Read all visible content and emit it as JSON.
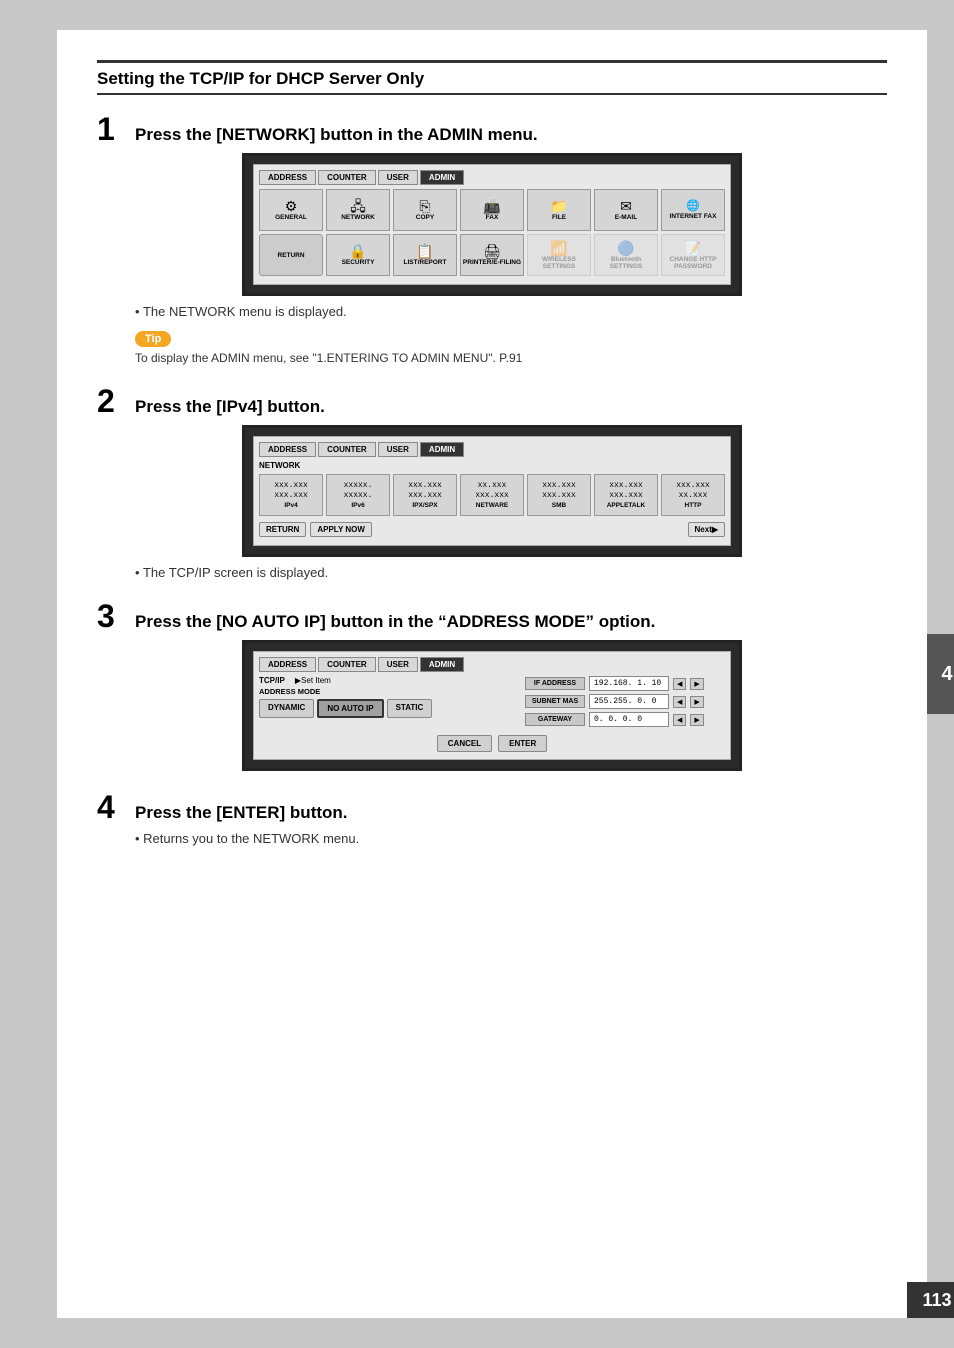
{
  "page": {
    "right_tab": "4",
    "page_number": "113"
  },
  "section": {
    "title": "Setting the TCP/IP for DHCP Server Only"
  },
  "steps": [
    {
      "number": "1",
      "instruction": "Press the [NETWORK] button in the ADMIN menu.",
      "bullet": "The NETWORK menu is displayed.",
      "tip": {
        "badge": "Tip",
        "text": "To display the ADMIN menu, see \"1.ENTERING TO ADMIN MENU\".  P.91"
      }
    },
    {
      "number": "2",
      "instruction": "Press the [IPv4] button.",
      "bullet": "The TCP/IP screen is displayed."
    },
    {
      "number": "3",
      "instruction": "Press the [NO AUTO IP] button in the “ADDRESS MODE” option."
    },
    {
      "number": "4",
      "instruction": "Press the [ENTER] button.",
      "bullet": "Returns you to the NETWORK menu."
    }
  ],
  "screen1": {
    "tabs": [
      "ADDRESS",
      "COUNTER",
      "USER",
      "ADMIN"
    ],
    "active_tab": "ADMIN",
    "icons_row1": [
      {
        "symbol": "⚙",
        "label": "GENERAL"
      },
      {
        "symbol": "🖧",
        "label": "NETWORK"
      },
      {
        "symbol": "⎘",
        "label": "COPY"
      },
      {
        "symbol": "📠",
        "label": "FAX"
      },
      {
        "symbol": "📁",
        "label": "FILE"
      },
      {
        "symbol": "✉",
        "label": "E-MAIL"
      },
      {
        "symbol": "🌐",
        "label": "INTERNET FAX"
      }
    ],
    "icons_row2": [
      {
        "symbol": "↩",
        "label": "RETURN"
      },
      {
        "symbol": "🔒",
        "label": "SECURITY"
      },
      {
        "symbol": "📋",
        "label": "LIST/REPORT"
      },
      {
        "symbol": "🖨",
        "label": "PRINTER\n/E-FILING"
      },
      {
        "symbol": "📶",
        "label": "WIRELESS\nSETTINGS",
        "dimmed": true
      },
      {
        "symbol": "🔵",
        "label": "Bluetooth\nSETTINGS",
        "dimmed": true
      },
      {
        "symbol": "📝",
        "label": "CHANGE HTTP\nPASSWORD",
        "dimmed": true
      }
    ]
  },
  "screen2": {
    "tabs": [
      "ADDRESS",
      "COUNTER",
      "USER",
      "ADMIN"
    ],
    "active_tab": "ADMIN",
    "label": "NETWORK",
    "icons": [
      {
        "sym": "xxx\nxxx",
        "lbl": "IPv4"
      },
      {
        "sym": "xxxx\nxxxx",
        "lbl": "IPv6"
      },
      {
        "sym": "xxx\nxxx",
        "lbl": "IPX/SPX"
      },
      {
        "sym": "xxx\nxxx",
        "lbl": "NETWARE"
      },
      {
        "sym": "xxx\nxxx",
        "lbl": "SMB"
      },
      {
        "sym": "xxx\nxxx",
        "lbl": "APPLETALK"
      },
      {
        "sym": "xxx\nxx",
        "lbl": "HTTP"
      }
    ],
    "buttons": [
      "RETURN",
      "APPLY NOW"
    ],
    "next": "Next"
  },
  "screen3": {
    "tabs": [
      "ADDRESS",
      "COUNTER",
      "USER",
      "ADMIN"
    ],
    "active_tab": "ADMIN",
    "header": "TCP/IP",
    "header_sub": "▶Set Item",
    "address_mode_label": "ADDRESS MODE",
    "mode_buttons": [
      "DYNAMIC",
      "NO AUTO IP",
      "STATIC"
    ],
    "selected_mode": "NO AUTO IP",
    "ip_fields": [
      {
        "label": "IF ADDRESS",
        "value": "192.168.  1. 10"
      },
      {
        "label": "SUBNET MAS",
        "value": "255.255.  0.  0"
      },
      {
        "label": "GATEWAY",
        "value": "  0.  0.  0.  0"
      }
    ],
    "footer_buttons": [
      "CANCEL",
      "ENTER"
    ]
  }
}
